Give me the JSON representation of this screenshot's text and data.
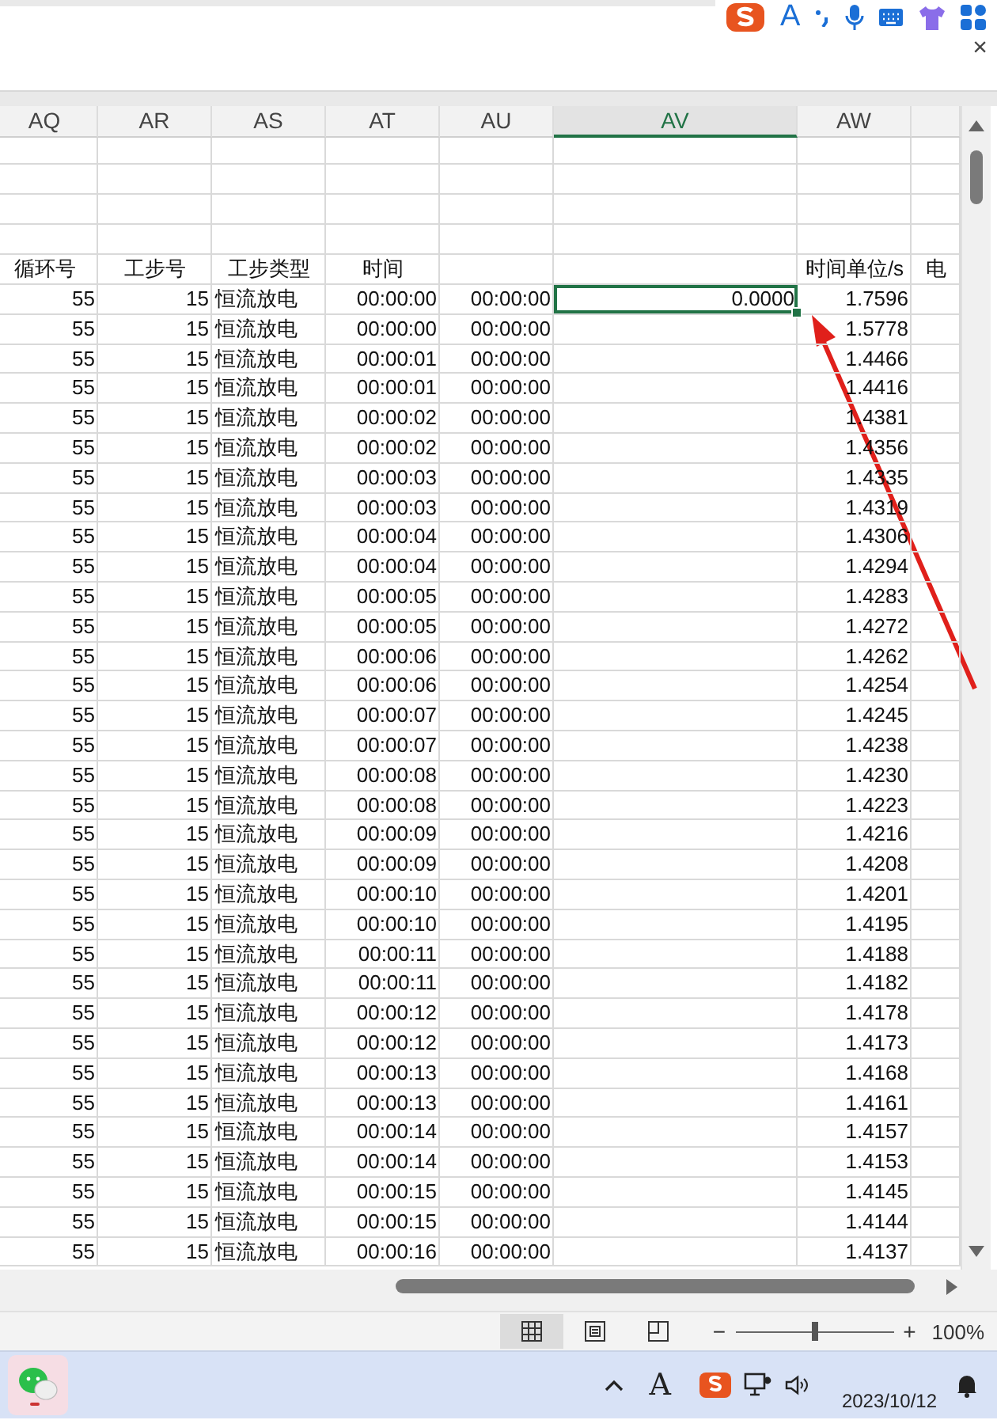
{
  "ime_toolbar": {
    "mode_label": "A"
  },
  "formula_area": {
    "close_glyph": "×"
  },
  "columns": [
    {
      "letter": "AQ",
      "header": "循环号",
      "selected": false
    },
    {
      "letter": "AR",
      "header": "工步号",
      "selected": false
    },
    {
      "letter": "AS",
      "header": "工步类型",
      "selected": false
    },
    {
      "letter": "AT",
      "header": "时间",
      "selected": false
    },
    {
      "letter": "AU",
      "selected": false
    },
    {
      "letter": "AV",
      "selected": true
    },
    {
      "letter": "AW",
      "header": "时间单位/s",
      "selected": false
    },
    {
      "header": "电",
      "selected": false
    }
  ],
  "rows": [
    {
      "cycle_no": "55",
      "step_no": "15",
      "step_type": "恒流放电",
      "time": "00:00:00",
      "column_5": "00:00:00",
      "column_6": "0.0000",
      "time_unit_s": "1.7596",
      "selected": true
    },
    {
      "cycle_no": "55",
      "step_no": "15",
      "step_type": "恒流放电",
      "time": "00:00:00",
      "column_5": "00:00:00",
      "time_unit_s": "1.5778",
      "selected": false
    },
    {
      "cycle_no": "55",
      "step_no": "15",
      "step_type": "恒流放电",
      "time": "00:00:01",
      "column_5": "00:00:00",
      "time_unit_s": "1.4466",
      "selected": false
    },
    {
      "cycle_no": "55",
      "step_no": "15",
      "step_type": "恒流放电",
      "time": "00:00:01",
      "column_5": "00:00:00",
      "time_unit_s": "1.4416",
      "selected": false
    },
    {
      "cycle_no": "55",
      "step_no": "15",
      "step_type": "恒流放电",
      "time": "00:00:02",
      "column_5": "00:00:00",
      "time_unit_s": "1.4381",
      "selected": false
    },
    {
      "cycle_no": "55",
      "step_no": "15",
      "step_type": "恒流放电",
      "time": "00:00:02",
      "column_5": "00:00:00",
      "time_unit_s": "1.4356",
      "selected": false
    },
    {
      "cycle_no": "55",
      "step_no": "15",
      "step_type": "恒流放电",
      "time": "00:00:03",
      "column_5": "00:00:00",
      "time_unit_s": "1.4335",
      "selected": false
    },
    {
      "cycle_no": "55",
      "step_no": "15",
      "step_type": "恒流放电",
      "time": "00:00:03",
      "column_5": "00:00:00",
      "time_unit_s": "1.4319",
      "selected": false
    },
    {
      "cycle_no": "55",
      "step_no": "15",
      "step_type": "恒流放电",
      "time": "00:00:04",
      "column_5": "00:00:00",
      "time_unit_s": "1.4306",
      "selected": false
    },
    {
      "cycle_no": "55",
      "step_no": "15",
      "step_type": "恒流放电",
      "time": "00:00:04",
      "column_5": "00:00:00",
      "time_unit_s": "1.4294",
      "selected": false
    },
    {
      "cycle_no": "55",
      "step_no": "15",
      "step_type": "恒流放电",
      "time": "00:00:05",
      "column_5": "00:00:00",
      "time_unit_s": "1.4283",
      "selected": false
    },
    {
      "cycle_no": "55",
      "step_no": "15",
      "step_type": "恒流放电",
      "time": "00:00:05",
      "column_5": "00:00:00",
      "time_unit_s": "1.4272",
      "selected": false
    },
    {
      "cycle_no": "55",
      "step_no": "15",
      "step_type": "恒流放电",
      "time": "00:00:06",
      "column_5": "00:00:00",
      "time_unit_s": "1.4262",
      "selected": false
    },
    {
      "cycle_no": "55",
      "step_no": "15",
      "step_type": "恒流放电",
      "time": "00:00:06",
      "column_5": "00:00:00",
      "time_unit_s": "1.4254",
      "selected": false
    },
    {
      "cycle_no": "55",
      "step_no": "15",
      "step_type": "恒流放电",
      "time": "00:00:07",
      "column_5": "00:00:00",
      "time_unit_s": "1.4245",
      "selected": false
    },
    {
      "cycle_no": "55",
      "step_no": "15",
      "step_type": "恒流放电",
      "time": "00:00:07",
      "column_5": "00:00:00",
      "time_unit_s": "1.4238",
      "selected": false
    },
    {
      "cycle_no": "55",
      "step_no": "15",
      "step_type": "恒流放电",
      "time": "00:00:08",
      "column_5": "00:00:00",
      "time_unit_s": "1.4230",
      "selected": false
    },
    {
      "cycle_no": "55",
      "step_no": "15",
      "step_type": "恒流放电",
      "time": "00:00:08",
      "column_5": "00:00:00",
      "time_unit_s": "1.4223",
      "selected": false
    },
    {
      "cycle_no": "55",
      "step_no": "15",
      "step_type": "恒流放电",
      "time": "00:00:09",
      "column_5": "00:00:00",
      "time_unit_s": "1.4216",
      "selected": false
    },
    {
      "cycle_no": "55",
      "step_no": "15",
      "step_type": "恒流放电",
      "time": "00:00:09",
      "column_5": "00:00:00",
      "time_unit_s": "1.4208",
      "selected": false
    },
    {
      "cycle_no": "55",
      "step_no": "15",
      "step_type": "恒流放电",
      "time": "00:00:10",
      "column_5": "00:00:00",
      "time_unit_s": "1.4201",
      "selected": false
    },
    {
      "cycle_no": "55",
      "step_no": "15",
      "step_type": "恒流放电",
      "time": "00:00:10",
      "column_5": "00:00:00",
      "time_unit_s": "1.4195",
      "selected": false
    },
    {
      "cycle_no": "55",
      "step_no": "15",
      "step_type": "恒流放电",
      "time": "00:00:11",
      "column_5": "00:00:00",
      "time_unit_s": "1.4188",
      "selected": false
    },
    {
      "cycle_no": "55",
      "step_no": "15",
      "step_type": "恒流放电",
      "time": "00:00:11",
      "column_5": "00:00:00",
      "time_unit_s": "1.4182",
      "selected": false
    },
    {
      "cycle_no": "55",
      "step_no": "15",
      "step_type": "恒流放电",
      "time": "00:00:12",
      "column_5": "00:00:00",
      "time_unit_s": "1.4178",
      "selected": false
    },
    {
      "cycle_no": "55",
      "step_no": "15",
      "step_type": "恒流放电",
      "time": "00:00:12",
      "column_5": "00:00:00",
      "time_unit_s": "1.4173",
      "selected": false
    },
    {
      "cycle_no": "55",
      "step_no": "15",
      "step_type": "恒流放电",
      "time": "00:00:13",
      "column_5": "00:00:00",
      "time_unit_s": "1.4168",
      "selected": false
    },
    {
      "cycle_no": "55",
      "step_no": "15",
      "step_type": "恒流放电",
      "time": "00:00:13",
      "column_5": "00:00:00",
      "time_unit_s": "1.4161",
      "selected": false
    },
    {
      "cycle_no": "55",
      "step_no": "15",
      "step_type": "恒流放电",
      "time": "00:00:14",
      "column_5": "00:00:00",
      "time_unit_s": "1.4157",
      "selected": false
    },
    {
      "cycle_no": "55",
      "step_no": "15",
      "step_type": "恒流放电",
      "time": "00:00:14",
      "column_5": "00:00:00",
      "time_unit_s": "1.4153",
      "selected": false
    },
    {
      "cycle_no": "55",
      "step_no": "15",
      "step_type": "恒流放电",
      "time": "00:00:15",
      "column_5": "00:00:00",
      "time_unit_s": "1.4145",
      "selected": false
    },
    {
      "cycle_no": "55",
      "step_no": "15",
      "step_type": "恒流放电",
      "time": "00:00:15",
      "column_5": "00:00:00",
      "time_unit_s": "1.4144",
      "selected": false
    },
    {
      "cycle_no": "55",
      "step_no": "15",
      "step_type": "恒流放电",
      "time": "00:00:16",
      "column_5": "00:00:00",
      "time_unit_s": "1.4137",
      "selected": false
    }
  ],
  "status_bar": {
    "views": [
      {
        "kind": "normal",
        "selected": true
      },
      {
        "kind": "page",
        "selected": false
      },
      {
        "kind": "break",
        "selected": false
      }
    ],
    "zoom": {
      "minus": "−",
      "plus": "+",
      "level": 0.5,
      "reading": "100%"
    }
  },
  "taskbar": {
    "tray_label": "A",
    "date": "2023/10/12"
  }
}
